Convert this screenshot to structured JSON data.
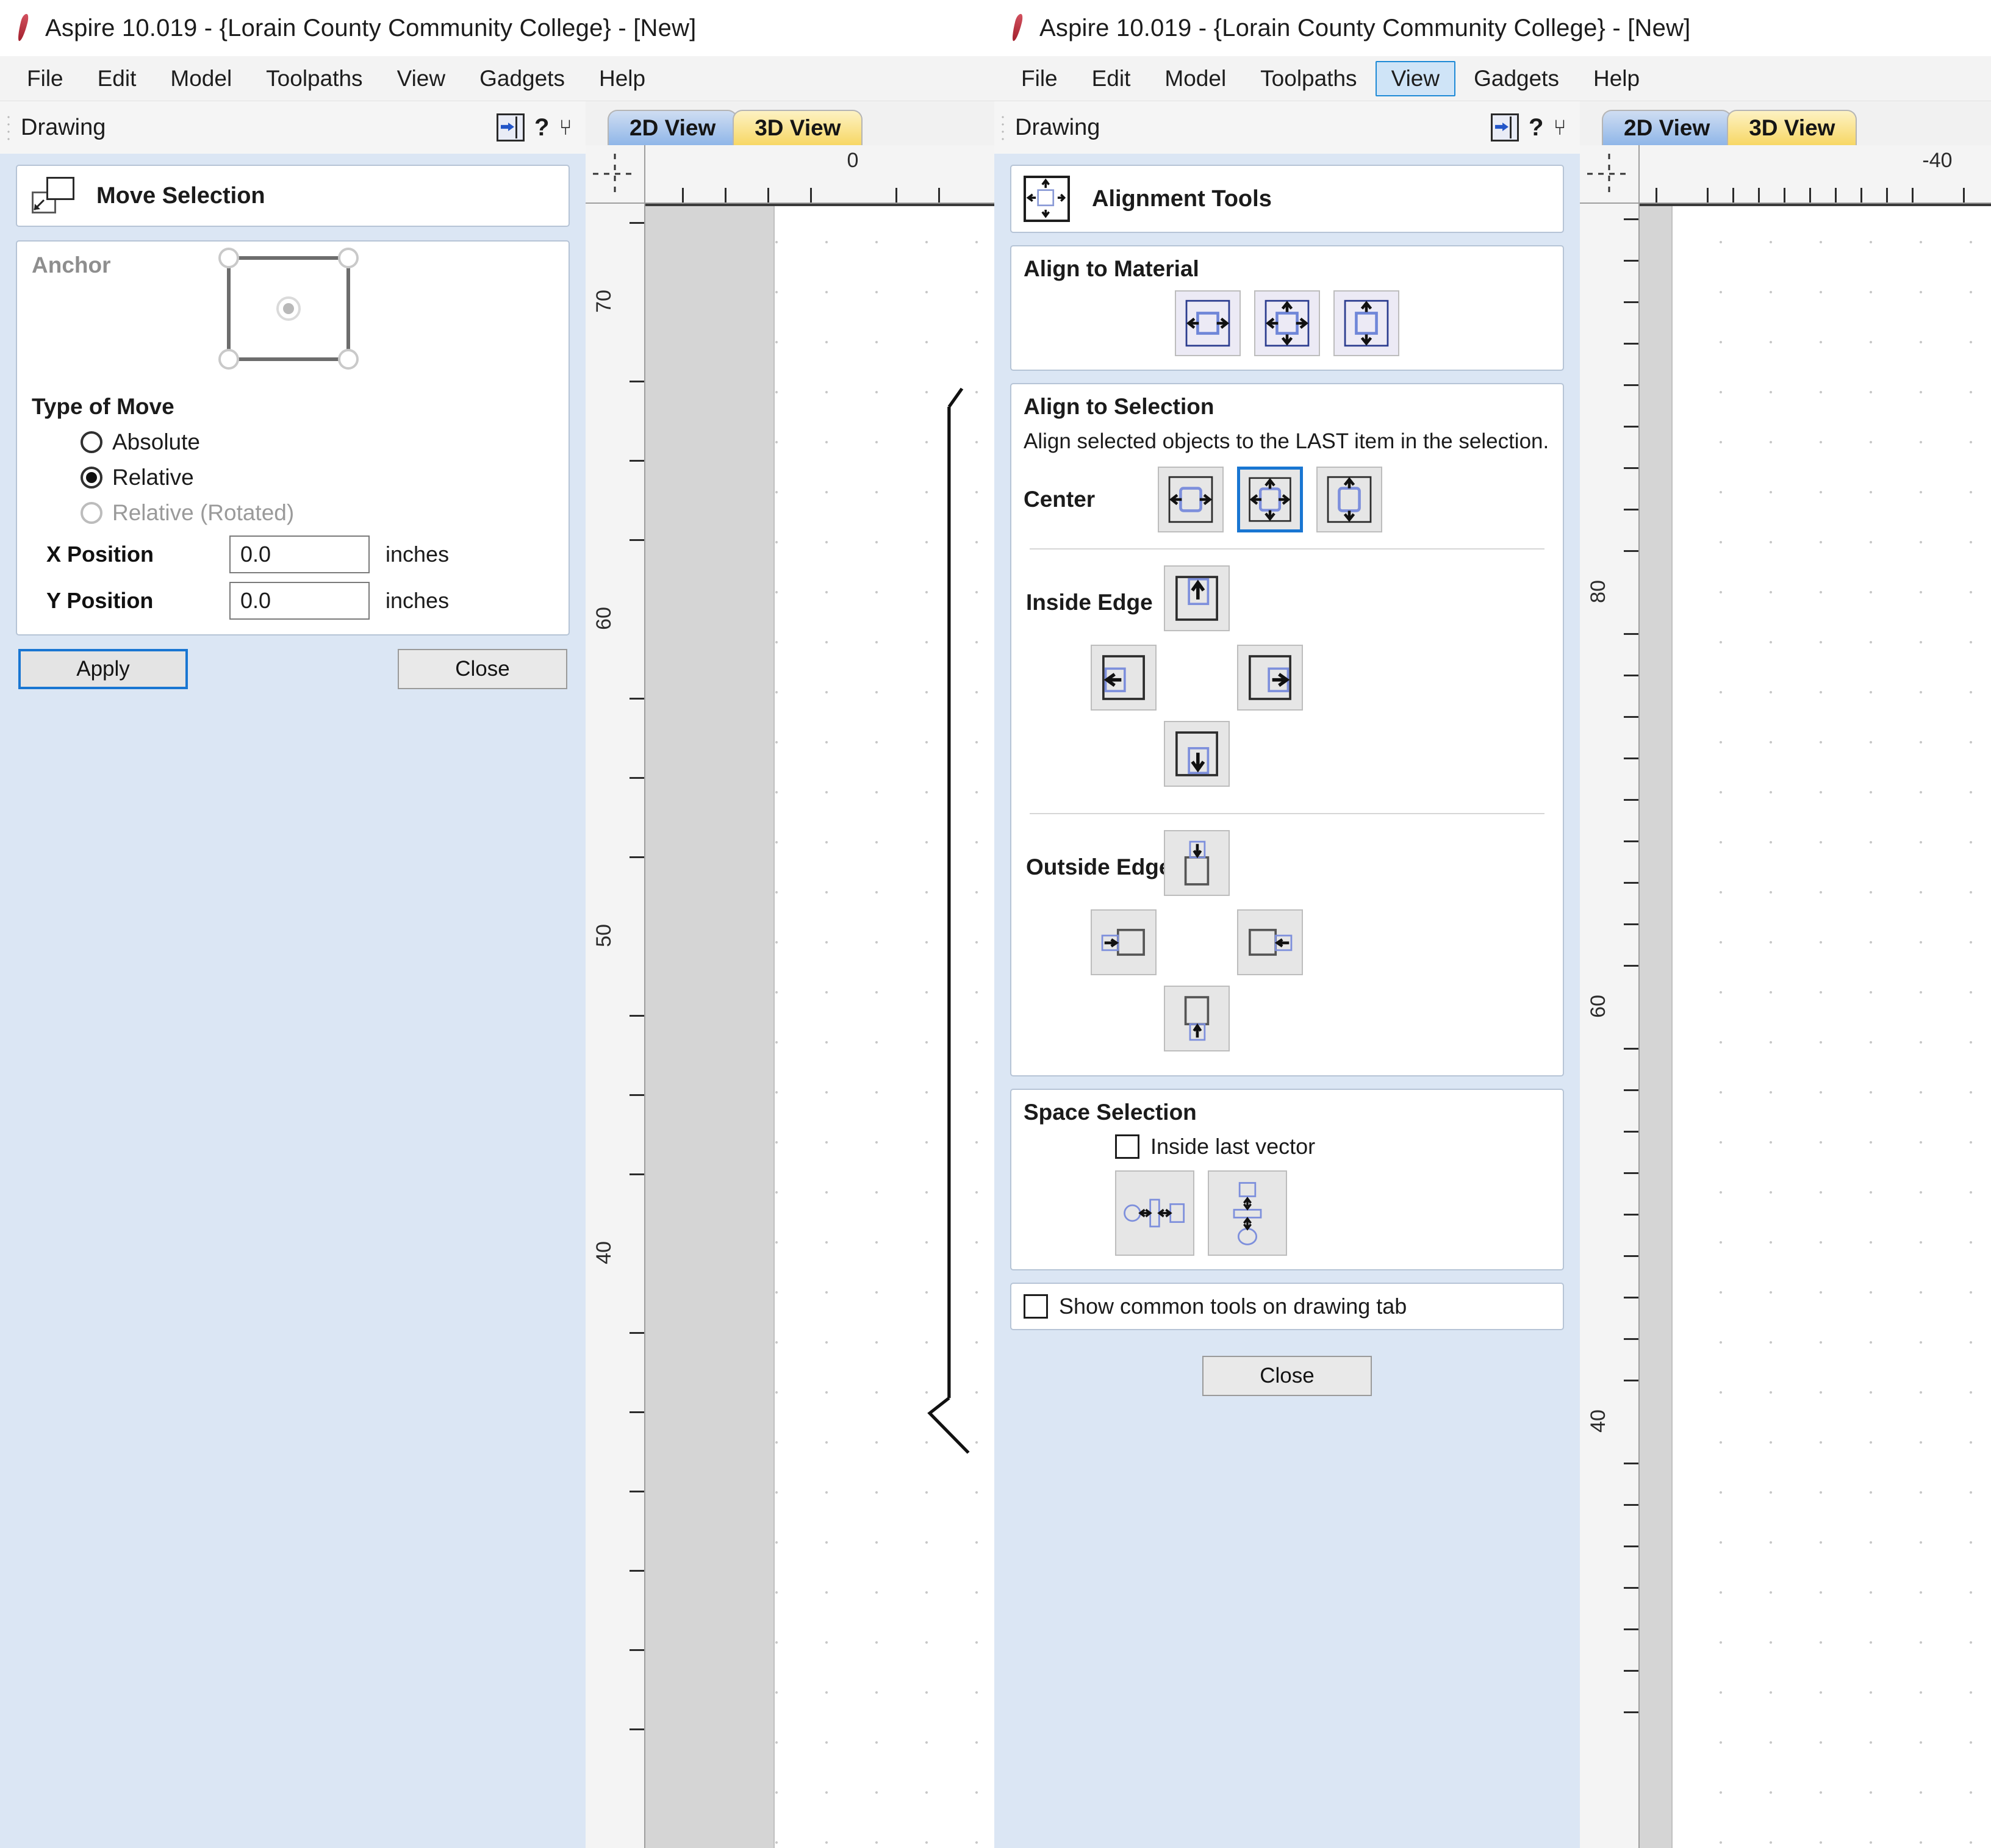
{
  "windows": [
    {
      "id": "move-selection-window",
      "titlebar": {
        "title": "Aspire 10.019 - {Lorain County Community College} - [New]",
        "logo_icon": "aspire-logo-icon"
      },
      "menubar": {
        "items": [
          {
            "label": "File",
            "active": false
          },
          {
            "label": "Edit",
            "active": false
          },
          {
            "label": "Model",
            "active": false
          },
          {
            "label": "Toolpaths",
            "active": false
          },
          {
            "label": "View",
            "active": false
          },
          {
            "label": "Gadgets",
            "active": false
          },
          {
            "label": "Help",
            "active": false
          }
        ]
      },
      "panel": {
        "title": "Drawing",
        "header_icons": [
          "auto-hide-icon",
          "help-icon",
          "pin-icon"
        ],
        "help_glyph": "?",
        "pin_glyph": "⑂",
        "tool_title": "Move Selection",
        "tool_icon": "move-selection-icon",
        "anchor": {
          "label": "Anchor",
          "selected": "center"
        },
        "type_of_move": {
          "label": "Type of Move",
          "options": [
            {
              "label": "Absolute",
              "selected": false,
              "disabled": false
            },
            {
              "label": "Relative",
              "selected": true,
              "disabled": false
            },
            {
              "label": "Relative (Rotated)",
              "selected": false,
              "disabled": true
            }
          ]
        },
        "fields": [
          {
            "label": "X Position",
            "value": "0.0",
            "unit": "inches"
          },
          {
            "label": "Y Position",
            "value": "0.0",
            "unit": "inches"
          }
        ],
        "buttons": {
          "apply": "Apply",
          "close": "Close"
        }
      },
      "view": {
        "tabs": [
          {
            "label": "2D View",
            "active": true
          },
          {
            "label": "3D View",
            "active": false
          }
        ],
        "h_ruler_labels": [
          "0"
        ],
        "v_ruler_labels": [
          "70",
          "60",
          "50",
          "40"
        ]
      }
    },
    {
      "id": "alignment-tools-window",
      "titlebar": {
        "title": "Aspire 10.019 - {Lorain County Community College} - [New]",
        "logo_icon": "aspire-logo-icon"
      },
      "menubar": {
        "items": [
          {
            "label": "File",
            "active": false
          },
          {
            "label": "Edit",
            "active": false
          },
          {
            "label": "Model",
            "active": false
          },
          {
            "label": "Toolpaths",
            "active": false
          },
          {
            "label": "View",
            "active": true
          },
          {
            "label": "Gadgets",
            "active": false
          },
          {
            "label": "Help",
            "active": false
          }
        ]
      },
      "panel": {
        "title": "Drawing",
        "header_icons": [
          "auto-hide-icon",
          "help-icon",
          "pin-icon"
        ],
        "help_glyph": "?",
        "pin_glyph": "⑂",
        "tool_title": "Alignment Tools",
        "tool_icon": "alignment-tools-icon",
        "align_to_material": {
          "heading": "Align to Material",
          "buttons": [
            {
              "name": "align-material-center-horizontal",
              "icon": "center-horizontal-icon"
            },
            {
              "name": "align-material-center-both",
              "icon": "center-both-icon"
            },
            {
              "name": "align-material-center-vertical",
              "icon": "center-vertical-icon"
            }
          ]
        },
        "align_to_selection": {
          "heading": "Align to Selection",
          "description": "Align selected objects to the LAST item in the selection.",
          "center": {
            "label": "Center",
            "buttons": [
              {
                "name": "center-horizontal",
                "icon": "center-horizontal-icon",
                "selected": false
              },
              {
                "name": "center-both",
                "icon": "center-both-icon",
                "selected": true
              },
              {
                "name": "center-vertical",
                "icon": "center-vertical-icon",
                "selected": false
              }
            ]
          },
          "inside_edge": {
            "label": "Inside Edge",
            "buttons": [
              {
                "name": "inside-edge-top",
                "icon": "arrow-up-icon"
              },
              {
                "name": "inside-edge-left",
                "icon": "arrow-left-icon"
              },
              {
                "name": "inside-edge-right",
                "icon": "arrow-right-icon"
              },
              {
                "name": "inside-edge-bottom",
                "icon": "arrow-down-icon"
              }
            ]
          },
          "outside_edge": {
            "label": "Outside Edge",
            "buttons": [
              {
                "name": "outside-edge-top",
                "icon": "arrow-down-icon"
              },
              {
                "name": "outside-edge-left",
                "icon": "arrow-right-icon"
              },
              {
                "name": "outside-edge-right",
                "icon": "arrow-left-icon"
              },
              {
                "name": "outside-edge-bottom",
                "icon": "arrow-up-icon"
              }
            ]
          }
        },
        "space_selection": {
          "heading": "Space Selection",
          "checkbox": {
            "label": "Inside last vector",
            "checked": false
          },
          "buttons": [
            {
              "name": "space-horizontally",
              "icon": "space-horizontal-icon"
            },
            {
              "name": "space-vertically",
              "icon": "space-vertical-icon"
            }
          ]
        },
        "show_common_tools": {
          "label": "Show common tools on drawing tab",
          "checked": false
        },
        "buttons": {
          "close": "Close"
        }
      },
      "view": {
        "tabs": [
          {
            "label": "2D View",
            "active": true
          },
          {
            "label": "3D View",
            "active": false
          }
        ],
        "h_ruler_labels": [
          "-40"
        ],
        "v_ruler_labels": [
          "80",
          "60",
          "40"
        ]
      }
    }
  ],
  "colors": {
    "tab_2d": "#8fb6e8",
    "tab_3d": "#f7d765",
    "panel_bg": "#dbe6f4",
    "accent_blue": "#1976d2",
    "menu_active_bg": "#cfe4f7"
  }
}
